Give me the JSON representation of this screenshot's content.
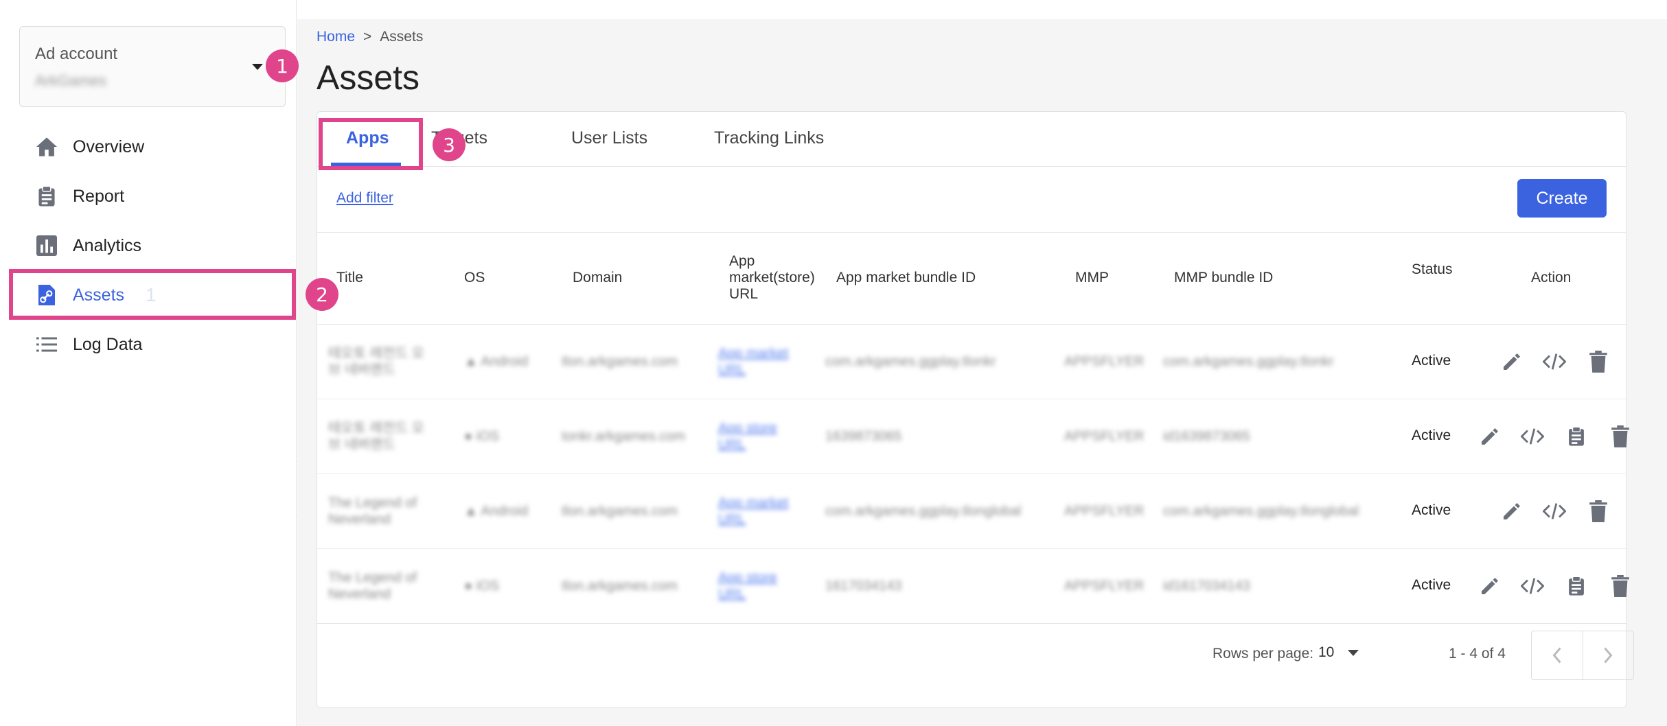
{
  "sidebar": {
    "account": {
      "label": "Ad account",
      "value": "ArkGames"
    },
    "items": [
      {
        "label": "Overview",
        "icon": "home-icon"
      },
      {
        "label": "Report",
        "icon": "clipboard-icon"
      },
      {
        "label": "Analytics",
        "icon": "bar-chart-icon"
      },
      {
        "label": "Assets",
        "icon": "link-file-icon",
        "active": true
      },
      {
        "label": "Log Data",
        "icon": "list-icon"
      }
    ],
    "ghost_number": "1"
  },
  "annotations": {
    "badge1": "1",
    "badge2": "2",
    "badge3": "3",
    "color": "#e0448a"
  },
  "breadcrumb": {
    "home": "Home",
    "separator": ">",
    "current": "Assets"
  },
  "page_title": "Assets",
  "tabs": [
    "Apps",
    "Targets",
    "User Lists",
    "Tracking Links"
  ],
  "filter": {
    "add_filter": "Add filter",
    "create": "Create"
  },
  "table": {
    "headers": {
      "title": "Title",
      "os": "OS",
      "domain": "Domain",
      "store_url_1": "App",
      "store_url_2": "market(store)",
      "store_url_3": "URL",
      "bundle_id": "App market bundle ID",
      "mmp": "MMP",
      "mmp_bundle": "MMP bundle ID",
      "status": "Status",
      "action": "Action"
    },
    "rows": [
      {
        "title1": "테오토 레전드 오",
        "title2": "브 네버랜드",
        "os": "Android",
        "domain": "tlon.arkgames.com",
        "url1": "App market",
        "url2": "URL",
        "bundle": "com.arkgames.ggplay.tlonkr",
        "mmp": "APPSFLYER",
        "mmp_bundle": "com.arkgames.ggplay.tlonkr",
        "status": "Active"
      },
      {
        "title1": "테오토 레전드 오",
        "title2": "브 네버랜드",
        "os": "iOS",
        "domain": "tonkr.arkgames.com",
        "url1": "App store",
        "url2": "URL",
        "bundle": "1639873065",
        "mmp": "APPSFLYER",
        "mmp_bundle": "id1639873065",
        "status": "Active"
      },
      {
        "title1": "The Legend of",
        "title2": "Neverland",
        "os": "Android",
        "domain": "tlon.arkgames.com",
        "url1": "App market",
        "url2": "URL",
        "bundle": "com.arkgames.ggplay.tlonglobal",
        "mmp": "APPSFLYER",
        "mmp_bundle": "com.arkgames.ggplay.tlonglobal",
        "status": "Active"
      },
      {
        "title1": "The Legend of",
        "title2": "Neverland",
        "os": "iOS",
        "domain": "tlon.arkgames.com",
        "url1": "App store",
        "url2": "URL",
        "bundle": "1617034143",
        "mmp": "APPSFLYER",
        "mmp_bundle": "id1617034143",
        "status": "Active"
      }
    ]
  },
  "pagination": {
    "rows_label": "Rows per page:",
    "rows_value": "10",
    "range": "1 - 4 of 4"
  },
  "colors": {
    "accent": "#3b63e0",
    "highlight": "#e0448a",
    "icon_gray": "#6b6f7a"
  }
}
